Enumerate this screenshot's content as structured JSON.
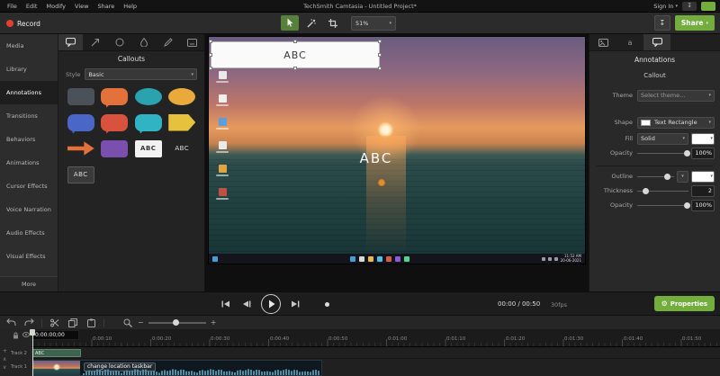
{
  "menubar": {
    "menus": [
      "File",
      "Edit",
      "Modify",
      "View",
      "Share",
      "Help"
    ],
    "title": "TechSmith Camtasia - Untitled Project*",
    "sign_in": "Sign In"
  },
  "toolbar": {
    "record": "Record",
    "zoom_level": "51%",
    "share": "Share"
  },
  "sidebar": {
    "items": [
      "Media",
      "Library",
      "Annotations",
      "Transitions",
      "Behaviors",
      "Animations",
      "Cursor Effects",
      "Voice Narration",
      "Audio Effects",
      "Visual Effects"
    ],
    "active_item": "Annotations",
    "more": "More"
  },
  "callouts_panel": {
    "title": "Callouts",
    "style_label": "Style",
    "style_value": "Basic",
    "abc": "ABC",
    "shapes": [
      {
        "name": "rounded-rectangle",
        "color": "#4a5158"
      },
      {
        "name": "speech-bubble",
        "color": "#e2713a"
      },
      {
        "name": "cloud",
        "color": "#2aa3ae"
      },
      {
        "name": "cloud",
        "color": "#e9a93b"
      },
      {
        "name": "speech-bubble",
        "color": "#4a67c8"
      },
      {
        "name": "speech-bubble",
        "color": "#d9523e"
      },
      {
        "name": "speech-bubble",
        "color": "#30b4c4"
      },
      {
        "name": "pentagon-arrow",
        "color": "#e6c13d"
      },
      {
        "name": "arrow",
        "color": "#e2713a"
      },
      {
        "name": "rounded-rectangle",
        "color": "#7a4fae"
      }
    ]
  },
  "preview": {
    "callout_text": "ABC",
    "overlay_text": "ABC",
    "taskbar_time": "11:52 AM",
    "taskbar_date": "20-06-2021"
  },
  "properties": {
    "tab_text_label": "a",
    "title": "Annotations",
    "subtitle": "Callout",
    "theme_label": "Theme",
    "theme_value": "Select theme...",
    "shape_label": "Shape",
    "shape_value": "Text Rectangle",
    "fill_label": "Fill",
    "fill_value": "Solid",
    "opacity_label": "Opacity",
    "opacity_value": "100%",
    "outline_label": "Outline",
    "thickness_label": "Thickness",
    "thickness_value": "2",
    "opacity2_label": "Opacity",
    "opacity2_value": "100%"
  },
  "playback": {
    "time_display": "00:00 / 00:50",
    "fps": "30fps",
    "properties_button": "Properties"
  },
  "timeline": {
    "playhead_time": "0:00:00;00",
    "ruler_labels": [
      "0:00:00",
      "0:00:10",
      "0:00:20",
      "0:00:30",
      "0:00:40",
      "0:00:50",
      "0:01:00",
      "0:01:10",
      "0:01:20",
      "0:01:30",
      "0:01:40",
      "0:01:50"
    ],
    "tracks": [
      {
        "name": "Track 2",
        "clip_label": "ABC"
      },
      {
        "name": "Track 1",
        "clip_label": "change location taskbar"
      }
    ]
  },
  "colors": {
    "accent_green": "#72ad3d",
    "record_red": "#e23f33"
  }
}
